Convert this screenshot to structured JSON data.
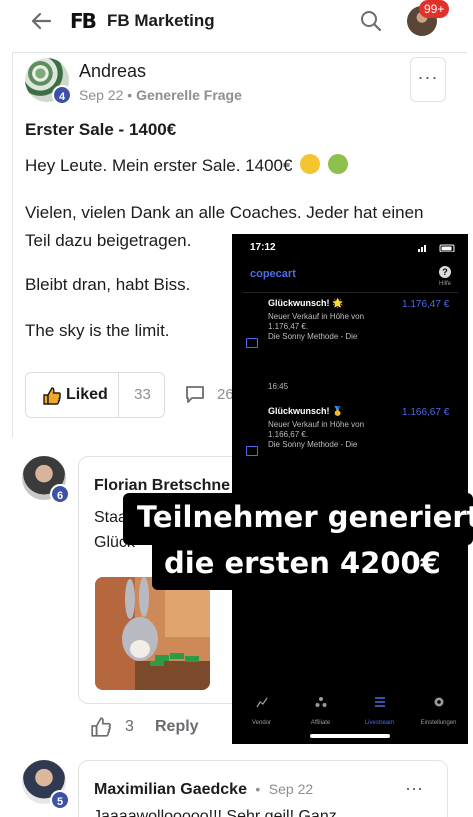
{
  "header": {
    "logo_text": "FB",
    "logo_sub": "MARKETING",
    "group_title": "FB Marketing",
    "notification_count": "99+"
  },
  "post": {
    "author": "Andreas",
    "level": "4",
    "date": "Sep 22",
    "separator": "•",
    "category": "Generelle Frage",
    "more": "···",
    "title": "Erster Sale - 1400€",
    "paragraphs": [
      "Hey Leute. Mein erster Sale. 1400€",
      "Vielen, vielen Dank an alle Coaches. Jeder hat einen",
      "Teil dazu beigetragen.",
      "Bleibt dran, habt Biss.",
      "The sky is the limit."
    ],
    "liked_label": "Liked",
    "like_count": "33",
    "comment_count": "26"
  },
  "comments": [
    {
      "author": "Florian Bretschne",
      "level": "6",
      "text_line1": "Staa",
      "text_line2": "Glück",
      "like_count": "3",
      "reply_label": "Reply"
    },
    {
      "author": "Maximilian Gaedcke",
      "level": "5",
      "separator": "•",
      "date": "Sep 22",
      "more": "···",
      "text": "Jaaaawollooooo!!! Sehr geil! Ganz"
    }
  ],
  "phone_overlay": {
    "time": "17:12",
    "brand": "copecart",
    "help_label": "Hilfe",
    "help_glyph": "?",
    "items": [
      {
        "title": "Glückwunsch! 🌟",
        "amount": "1.176,47 €",
        "desc1": "Neuer Verkauf in Höhe von",
        "desc2": "1.176,47 €.",
        "desc3": "Die Sonny Methode - Die"
      },
      {
        "title": "Glückwunsch! 🥇",
        "amount": "1.166,67 €",
        "desc1": "Neuer Verkauf in Höhe von",
        "desc2": "1.166,67 €.",
        "desc3": "Die Sonny Methode - Die"
      }
    ],
    "separator_time": "16:45",
    "tabs": [
      "Vendor",
      "Affiliate",
      "Livestream",
      "Einstellungen"
    ],
    "active_tab": "Livestream"
  },
  "caption": {
    "line1": "Teilnehmer generiert",
    "line2": "die ersten 4200€"
  },
  "colors": {
    "level_badge": "#3d52a6",
    "notification": "#e0312a",
    "copecart_blue": "#4d6ce5"
  }
}
